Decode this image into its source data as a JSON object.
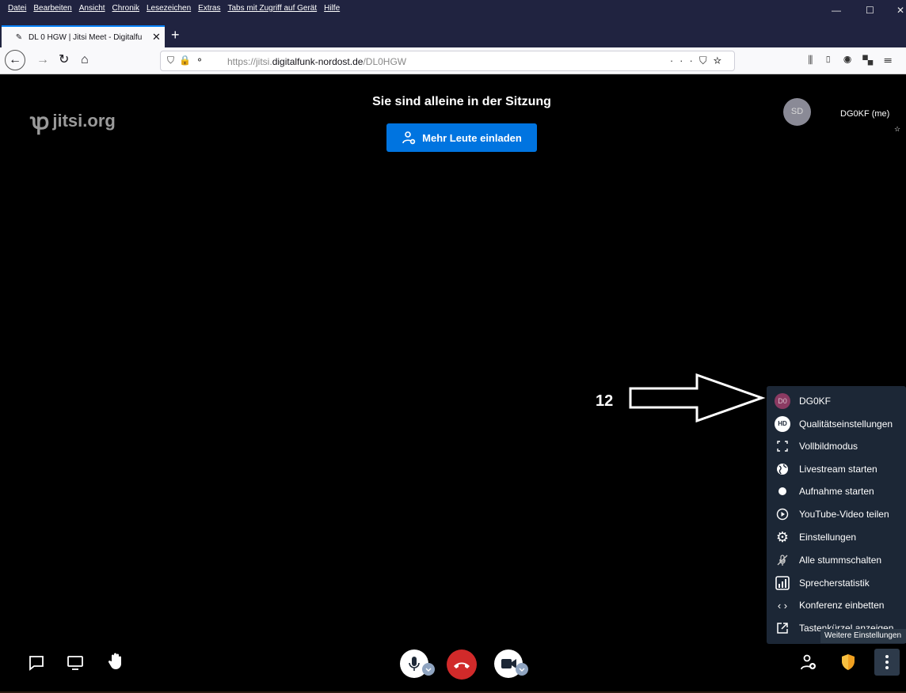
{
  "browser": {
    "menu": [
      "Datei",
      "Bearbeiten",
      "Ansicht",
      "Chronik",
      "Lesezeichen",
      "Extras",
      "Tabs mit Zugriff auf Gerät",
      "Hilfe"
    ],
    "tab_title": "DL 0 HGW | Jitsi Meet - Digitalfu",
    "url_host": "https://jitsi.",
    "url_domain": "digitalfunk-nordost.de",
    "url_path": "/DL0HGW"
  },
  "meeting": {
    "logo_text": "jitsi.org",
    "alone_message": "Sie sind alleine in der Sitzung",
    "invite_label": "Mehr Leute einladen",
    "local_avatar_initials": "SD",
    "local_name": "DG0KF (me)"
  },
  "annotation": {
    "number": "12"
  },
  "more_menu": {
    "items": [
      {
        "label": "DG0KF",
        "icon": "avatar-icon",
        "avatar_initials": "D0"
      },
      {
        "label": "Qualitätseinstellungen",
        "icon": "hd-icon",
        "badge": "HD"
      },
      {
        "label": "Vollbildmodus",
        "icon": "fullscreen-icon"
      },
      {
        "label": "Livestream starten",
        "icon": "globe-icon"
      },
      {
        "label": "Aufnahme starten",
        "icon": "record-icon"
      },
      {
        "label": "YouTube-Video teilen",
        "icon": "play-icon"
      },
      {
        "label": "Einstellungen",
        "icon": "gear-icon"
      },
      {
        "label": "Alle stummschalten",
        "icon": "mute-all-icon"
      },
      {
        "label": "Sprecherstatistik",
        "icon": "stats-icon"
      },
      {
        "label": "Konferenz einbetten",
        "icon": "embed-icon"
      },
      {
        "label": "Tastenkürzel anzeigen",
        "icon": "external-icon"
      }
    ],
    "tooltip": "Weitere Einstellungen"
  },
  "colors": {
    "invite_button": "#0074e0",
    "hangup": "#d12a2a",
    "menu_bg": "#1c2736",
    "shield": "#f0a020"
  }
}
